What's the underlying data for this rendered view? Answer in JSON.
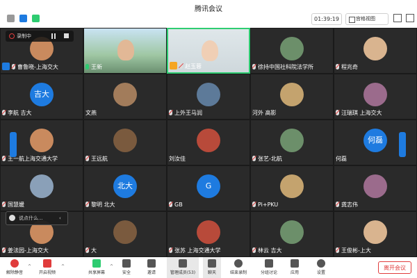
{
  "app": {
    "title": "腾讯会议"
  },
  "header": {
    "timer": "01:39:19",
    "view_label": "宫格视图"
  },
  "recording": {
    "label": "录制中"
  },
  "participants": [
    {
      "name": "曹鲁晓-上海交大",
      "icon": "host-badge",
      "mic": "off",
      "avatar": "photo"
    },
    {
      "name": "王新",
      "icon": "mic",
      "mic": "on",
      "avatar": "video"
    },
    {
      "name": "赵玉蓉",
      "icon": "cohost-badge",
      "mic": "off",
      "avatar": "video"
    },
    {
      "name": "徐持中国社科院法学所",
      "icon": "mic",
      "mic": "off",
      "avatar": "photo"
    },
    {
      "name": "程兆奇",
      "icon": "mic",
      "mic": "off",
      "avatar": "photo"
    },
    {
      "name": "李航 吉大",
      "icon": "mic",
      "mic": "off",
      "avatar": "text",
      "avatar_text": "吉大"
    },
    {
      "name": "文燕",
      "icon": "",
      "mic": "",
      "avatar": "photo"
    },
    {
      "name": "上外王马润",
      "icon": "mic",
      "mic": "off",
      "avatar": "photo"
    },
    {
      "name": "河外 高影",
      "icon": "",
      "mic": "",
      "avatar": "photo"
    },
    {
      "name": "汪瑞琪 上海交大",
      "icon": "mic",
      "mic": "off",
      "avatar": "photo"
    },
    {
      "name": "王一航上海交通大学",
      "icon": "mic",
      "mic": "off",
      "avatar": "photo"
    },
    {
      "name": "王远航",
      "icon": "mic",
      "mic": "off",
      "avatar": "photo"
    },
    {
      "name": "刘汝佳",
      "icon": "",
      "mic": "",
      "avatar": "photo"
    },
    {
      "name": "张艺-北航",
      "icon": "mic",
      "mic": "off",
      "avatar": "photo"
    },
    {
      "name": "何磊",
      "icon": "",
      "mic": "",
      "avatar": "text",
      "avatar_text": "何磊"
    },
    {
      "name": "国慧媛",
      "icon": "mic",
      "mic": "off",
      "avatar": "photo"
    },
    {
      "name": "黎明 北大",
      "icon": "mic",
      "mic": "off",
      "avatar": "text",
      "avatar_text": "北大"
    },
    {
      "name": "GB",
      "icon": "mic",
      "mic": "off",
      "avatar": "text",
      "avatar_text": "G"
    },
    {
      "name": "Pi+PKU",
      "icon": "mic",
      "mic": "off",
      "avatar": "photo"
    },
    {
      "name": "龚志伟",
      "icon": "mic",
      "mic": "off",
      "avatar": "photo"
    },
    {
      "name": "姜法园-上海交大",
      "icon": "mic",
      "mic": "off",
      "avatar": "photo"
    },
    {
      "name": "大",
      "icon": "mic",
      "mic": "off",
      "avatar": "photo"
    },
    {
      "name": "张苏 上海交通大学",
      "icon": "mic",
      "mic": "off",
      "avatar": "photo"
    },
    {
      "name": "林云 吉大",
      "icon": "mic",
      "mic": "off",
      "avatar": "photo"
    },
    {
      "name": "王俊彬-上大",
      "icon": "mic",
      "mic": "off",
      "avatar": "photo"
    }
  ],
  "chat": {
    "placeholder": "说点什么..."
  },
  "toolbar": {
    "mute": "解除静音",
    "video": "开启视频",
    "share": "共享屏幕",
    "security": "安全",
    "invite": "邀请",
    "members": "管理成员(53)",
    "chat": "聊天",
    "record": "结束录制",
    "breakout": "分组讨论",
    "apps": "应用",
    "settings": "设置",
    "leave": "离开会议"
  },
  "colors": {
    "accent": "#1e7be0",
    "danger": "#e03c3c",
    "active_speaker": "#2ecc71"
  }
}
